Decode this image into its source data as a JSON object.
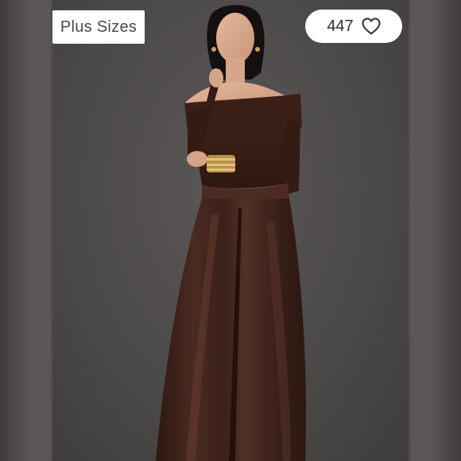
{
  "listing": {
    "tag_label": "Plus Sizes",
    "like_count": "447",
    "like_icon": "heart-outline-icon"
  },
  "colors": {
    "background": "#4f4d4c",
    "garment": "#3a2119",
    "badge_bg": "#ffffff",
    "badge_text": "#4a4a4a"
  }
}
